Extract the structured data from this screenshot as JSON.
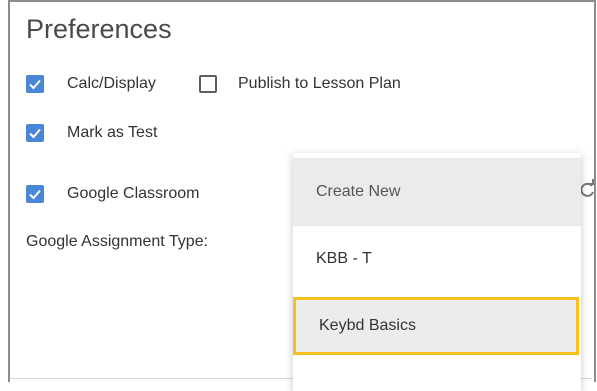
{
  "preferences": {
    "title": "Preferences",
    "options": [
      {
        "label": "Calc/Display",
        "checked": true
      },
      {
        "label": "Publish to Lesson Plan",
        "checked": false
      },
      {
        "label": "Mark as Test",
        "checked": true
      },
      {
        "label": "Google Classroom",
        "checked": true
      }
    ],
    "assignment_type_label": "Google Assignment Type:"
  },
  "dropdown": {
    "items": [
      {
        "label": "Create New"
      },
      {
        "label": "KBB - T"
      },
      {
        "label": "Keybd Basics",
        "highlighted": true
      }
    ]
  },
  "colors": {
    "accent": "#4a86d6",
    "highlight_border": "#f5c11f"
  },
  "icons": {
    "refresh": "refresh-icon",
    "check": "check-icon"
  }
}
